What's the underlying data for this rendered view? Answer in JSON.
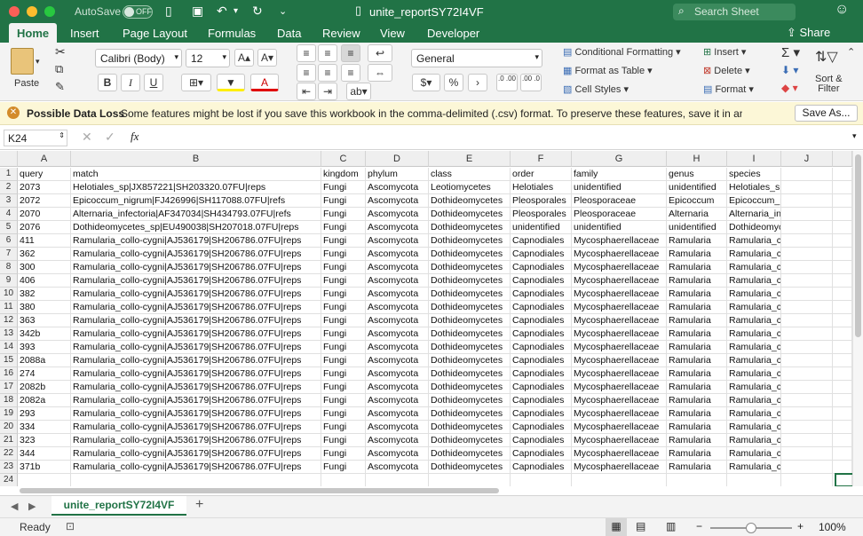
{
  "titlebar": {
    "autosave_label": "AutoSave",
    "autosave_state": "OFF",
    "window_title": "unite_reportSY72I4VF",
    "search_placeholder": "Search Sheet",
    "colors": {
      "brand": "#217346",
      "close": "#fc5f57",
      "minimize": "#fdbc2e",
      "maximize": "#28c840"
    }
  },
  "ribbon_tabs": [
    "Home",
    "Insert",
    "Page Layout",
    "Formulas",
    "Data",
    "Review",
    "View",
    "Developer"
  ],
  "share_label": "Share",
  "ribbon": {
    "paste_label": "Paste",
    "font_name": "Calibri (Body)",
    "font_size": "12",
    "bold": "B",
    "italic": "I",
    "underline": "U",
    "number_format": "General",
    "currency": "$",
    "percent": "%",
    "comma": "›",
    "increase_decimal": ".0 .00",
    "decrease_decimal": ".00 .0",
    "conditional_formatting": "Conditional Formatting",
    "format_as_table": "Format as Table",
    "cell_styles": "Cell Styles",
    "insert": "Insert",
    "delete": "Delete",
    "format": "Format",
    "sort_filter_1": "Sort &",
    "sort_filter_2": "Filter"
  },
  "message_bar": {
    "title": "Possible Data Loss",
    "text": "Some features might be lost if you save this workbook in the comma-delimited (.csv) format. To preserve these features, save it in an Exce…",
    "button": "Save As..."
  },
  "formula_bar": {
    "name_box": "K24",
    "fx": "fx",
    "value": ""
  },
  "sheet": {
    "columns": [
      {
        "letter": "A"
      },
      {
        "letter": "B"
      },
      {
        "letter": "C"
      },
      {
        "letter": "D"
      },
      {
        "letter": "E"
      },
      {
        "letter": "F"
      },
      {
        "letter": "G"
      },
      {
        "letter": "H"
      },
      {
        "letter": "I"
      },
      {
        "letter": "J"
      }
    ],
    "rows": [
      [
        "query",
        "match",
        "kingdom",
        "phylum",
        "class",
        "order",
        "family",
        "genus",
        "species",
        ""
      ],
      [
        "2073",
        "Helotiales_sp|JX857221|SH203320.07FU|reps",
        "Fungi",
        "Ascomycota",
        "Leotiomycetes",
        "Helotiales",
        "unidentified",
        "unidentified",
        "Helotiales_sp",
        ""
      ],
      [
        "2072",
        "Epicoccum_nigrum|FJ426996|SH117088.07FU|refs",
        "Fungi",
        "Ascomycota",
        "Dothideomycetes",
        "Pleosporales",
        "Pleosporaceae",
        "Epicoccum",
        "Epicoccum_nigrum",
        ""
      ],
      [
        "2070",
        "Alternaria_infectoria|AF347034|SH434793.07FU|refs",
        "Fungi",
        "Ascomycota",
        "Dothideomycetes",
        "Pleosporales",
        "Pleosporaceae",
        "Alternaria",
        "Alternaria_infectoria",
        ""
      ],
      [
        "2076",
        "Dothideomycetes_sp|EU490038|SH207018.07FU|reps",
        "Fungi",
        "Ascomycota",
        "Dothideomycetes",
        "unidentified",
        "unidentified",
        "unidentified",
        "Dothideomycetes_sp",
        ""
      ],
      [
        "411",
        "Ramularia_collo-cygni|AJ536179|SH206786.07FU|reps",
        "Fungi",
        "Ascomycota",
        "Dothideomycetes",
        "Capnodiales",
        "Mycosphaerellaceae",
        "Ramularia",
        "Ramularia_collo-cygni",
        ""
      ],
      [
        "362",
        "Ramularia_collo-cygni|AJ536179|SH206786.07FU|reps",
        "Fungi",
        "Ascomycota",
        "Dothideomycetes",
        "Capnodiales",
        "Mycosphaerellaceae",
        "Ramularia",
        "Ramularia_collo-cygni",
        ""
      ],
      [
        "300",
        "Ramularia_collo-cygni|AJ536179|SH206786.07FU|reps",
        "Fungi",
        "Ascomycota",
        "Dothideomycetes",
        "Capnodiales",
        "Mycosphaerellaceae",
        "Ramularia",
        "Ramularia_collo-cygni",
        ""
      ],
      [
        "406",
        "Ramularia_collo-cygni|AJ536179|SH206786.07FU|reps",
        "Fungi",
        "Ascomycota",
        "Dothideomycetes",
        "Capnodiales",
        "Mycosphaerellaceae",
        "Ramularia",
        "Ramularia_collo-cygni",
        ""
      ],
      [
        "382",
        "Ramularia_collo-cygni|AJ536179|SH206786.07FU|reps",
        "Fungi",
        "Ascomycota",
        "Dothideomycetes",
        "Capnodiales",
        "Mycosphaerellaceae",
        "Ramularia",
        "Ramularia_collo-cygni",
        ""
      ],
      [
        "380",
        "Ramularia_collo-cygni|AJ536179|SH206786.07FU|reps",
        "Fungi",
        "Ascomycota",
        "Dothideomycetes",
        "Capnodiales",
        "Mycosphaerellaceae",
        "Ramularia",
        "Ramularia_collo-cygni",
        ""
      ],
      [
        "363",
        "Ramularia_collo-cygni|AJ536179|SH206786.07FU|reps",
        "Fungi",
        "Ascomycota",
        "Dothideomycetes",
        "Capnodiales",
        "Mycosphaerellaceae",
        "Ramularia",
        "Ramularia_collo-cygni",
        ""
      ],
      [
        "342b",
        "Ramularia_collo-cygni|AJ536179|SH206786.07FU|reps",
        "Fungi",
        "Ascomycota",
        "Dothideomycetes",
        "Capnodiales",
        "Mycosphaerellaceae",
        "Ramularia",
        "Ramularia_collo-cygni",
        ""
      ],
      [
        "393",
        "Ramularia_collo-cygni|AJ536179|SH206786.07FU|reps",
        "Fungi",
        "Ascomycota",
        "Dothideomycetes",
        "Capnodiales",
        "Mycosphaerellaceae",
        "Ramularia",
        "Ramularia_collo-cygni",
        ""
      ],
      [
        "2088a",
        "Ramularia_collo-cygni|AJ536179|SH206786.07FU|reps",
        "Fungi",
        "Ascomycota",
        "Dothideomycetes",
        "Capnodiales",
        "Mycosphaerellaceae",
        "Ramularia",
        "Ramularia_collo-cygni",
        ""
      ],
      [
        "274",
        "Ramularia_collo-cygni|AJ536179|SH206786.07FU|reps",
        "Fungi",
        "Ascomycota",
        "Dothideomycetes",
        "Capnodiales",
        "Mycosphaerellaceae",
        "Ramularia",
        "Ramularia_collo-cygni",
        ""
      ],
      [
        "2082b",
        "Ramularia_collo-cygni|AJ536179|SH206786.07FU|reps",
        "Fungi",
        "Ascomycota",
        "Dothideomycetes",
        "Capnodiales",
        "Mycosphaerellaceae",
        "Ramularia",
        "Ramularia_collo-cygni",
        ""
      ],
      [
        "2082a",
        "Ramularia_collo-cygni|AJ536179|SH206786.07FU|reps",
        "Fungi",
        "Ascomycota",
        "Dothideomycetes",
        "Capnodiales",
        "Mycosphaerellaceae",
        "Ramularia",
        "Ramularia_collo-cygni",
        ""
      ],
      [
        "293",
        "Ramularia_collo-cygni|AJ536179|SH206786.07FU|reps",
        "Fungi",
        "Ascomycota",
        "Dothideomycetes",
        "Capnodiales",
        "Mycosphaerellaceae",
        "Ramularia",
        "Ramularia_collo-cygni",
        ""
      ],
      [
        "334",
        "Ramularia_collo-cygni|AJ536179|SH206786.07FU|reps",
        "Fungi",
        "Ascomycota",
        "Dothideomycetes",
        "Capnodiales",
        "Mycosphaerellaceae",
        "Ramularia",
        "Ramularia_collo-cygni",
        ""
      ],
      [
        "323",
        "Ramularia_collo-cygni|AJ536179|SH206786.07FU|reps",
        "Fungi",
        "Ascomycota",
        "Dothideomycetes",
        "Capnodiales",
        "Mycosphaerellaceae",
        "Ramularia",
        "Ramularia_collo-cygni",
        ""
      ],
      [
        "344",
        "Ramularia_collo-cygni|AJ536179|SH206786.07FU|reps",
        "Fungi",
        "Ascomycota",
        "Dothideomycetes",
        "Capnodiales",
        "Mycosphaerellaceae",
        "Ramularia",
        "Ramularia_collo-cygni",
        ""
      ],
      [
        "371b",
        "Ramularia_collo-cygni|AJ536179|SH206786.07FU|reps",
        "Fungi",
        "Ascomycota",
        "Dothideomycetes",
        "Capnodiales",
        "Mycosphaerellaceae",
        "Ramularia",
        "Ramularia_collo-cygni",
        ""
      ],
      [
        "",
        "",
        "",
        "",
        "",
        "",
        "",
        "",
        "",
        ""
      ]
    ]
  },
  "sheet_tab": {
    "name": "unite_reportSY72I4VF",
    "add": "+"
  },
  "status": {
    "ready": "Ready",
    "zoom": "100%",
    "zoom_level": 1.0
  }
}
